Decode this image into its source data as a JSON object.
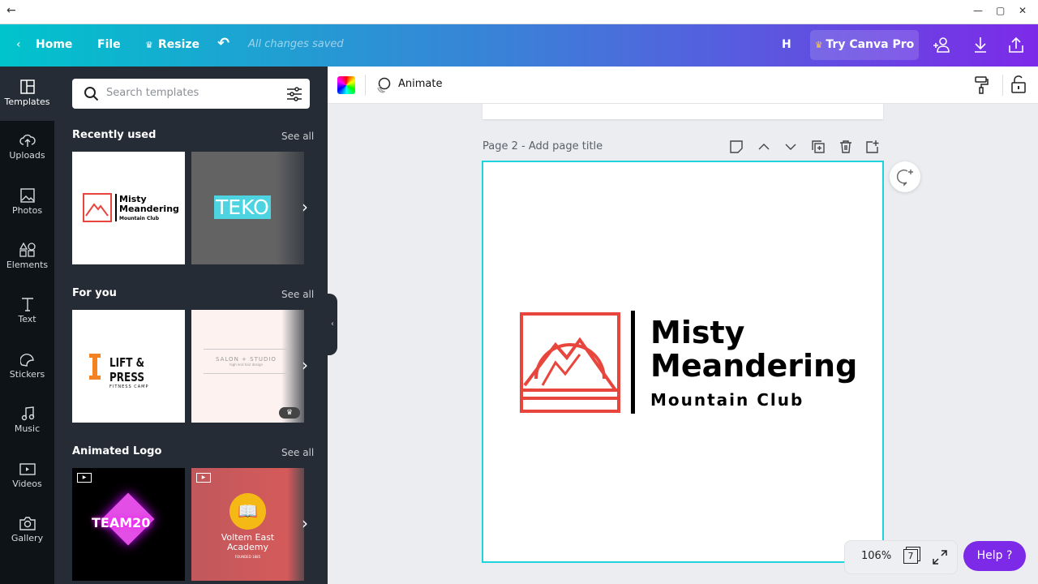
{
  "window": {
    "back_icon": "arrow-left-icon",
    "minimize": "—",
    "maximize": "▢",
    "close": "✕"
  },
  "topbar": {
    "home": "Home",
    "file": "File",
    "resize": "Resize",
    "status": "All changes saved",
    "user_initial": "H",
    "try_pro": "Try Canva Pro"
  },
  "rail": [
    {
      "label": "Templates",
      "icon": "templates-icon"
    },
    {
      "label": "Uploads",
      "icon": "upload-cloud-icon"
    },
    {
      "label": "Photos",
      "icon": "photo-icon"
    },
    {
      "label": "Elements",
      "icon": "shapes-icon"
    },
    {
      "label": "Text",
      "icon": "text-icon"
    },
    {
      "label": "Stickers",
      "icon": "sticker-icon"
    },
    {
      "label": "Music",
      "icon": "music-icon"
    },
    {
      "label": "Videos",
      "icon": "video-icon"
    },
    {
      "label": "Gallery",
      "icon": "camera-icon"
    }
  ],
  "panel": {
    "search_placeholder": "Search templates",
    "sections": [
      {
        "title": "Recently used",
        "see_all": "See all",
        "cards": [
          {
            "line1": "Misty",
            "line2": "Meandering",
            "line3": "Mountain Club"
          },
          {
            "text": "TEKO"
          }
        ]
      },
      {
        "title": "For you",
        "see_all": "See all",
        "cards": [
          {
            "line1": "LIFT & PRESS",
            "line2": "FITNESS CAMP"
          },
          {
            "line1": "SALON + STUDIO",
            "line2": "high end hair design"
          }
        ]
      },
      {
        "title": "Animated Logo",
        "see_all": "See all",
        "cards": [
          {
            "text": "TEAM20"
          },
          {
            "line1": "Voltem East",
            "line2": "Academy",
            "line3": "FOUNDED 1885"
          }
        ]
      }
    ]
  },
  "toolbar": {
    "animate": "Animate"
  },
  "page": {
    "label": "Page 2 - ",
    "title_placeholder": "Add page title"
  },
  "logo": {
    "line1": "Misty",
    "line2": "Meandering",
    "line3": "Mountain Club",
    "color": "#e8453c"
  },
  "footer": {
    "zoom": "106%",
    "page_count": "7",
    "help": "Help ?"
  },
  "colors": {
    "accent": "#00c4cc",
    "purple": "#7d2ae8",
    "selection": "#1fd3dd"
  }
}
